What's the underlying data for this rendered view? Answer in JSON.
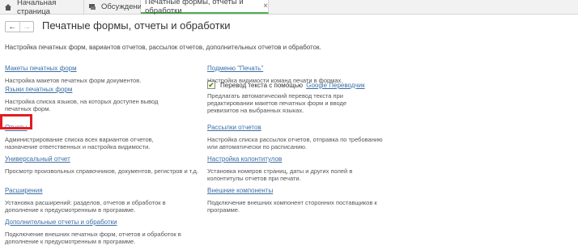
{
  "tabs": [
    {
      "label": "Начальная страница",
      "icon": "home-icon"
    },
    {
      "label": "Обсуждения",
      "icon": "chat-icon"
    },
    {
      "label": "Печатные формы, отчеты и обработки",
      "icon": "",
      "active": true
    }
  ],
  "header": {
    "title": "Печатные формы, отчеты и обработки",
    "description": "Настройка печатных форм, вариантов отчетов, рассылок отчетов, дополнительных отчетов и обработок."
  },
  "left_items": [
    {
      "label": "Макеты печатных форм",
      "desc": [
        "Настройка макетов печатных форм документов."
      ]
    },
    {
      "label": "Языки печатных форм",
      "desc": [
        "Настройка списка языков, на которых доступен вывод",
        "печатных форм."
      ]
    },
    {
      "label": "Отчеты",
      "desc": [
        "Администрирование списка всех вариантов отчетов,",
        "назначение ответственных и настройка видимости."
      ]
    },
    {
      "label": "Универсальный отчет",
      "desc": [
        "Просмотр произвольных справочников, документов, регистров и т.д."
      ]
    },
    {
      "label": "Расширения",
      "desc": [
        "Установка расширений: разделов, отчетов и обработок в",
        "дополнение к предусмотренным в программе."
      ]
    },
    {
      "label": "Дополнительные отчеты и обработки",
      "desc": [
        "Подключение внешних печатных форм, отчетов и обработок в",
        "дополнение к предусмотренным в программе."
      ]
    }
  ],
  "right_items": [
    {
      "label": "Подменю \"Печать\"",
      "desc": [
        "Настройка видимости команд печати в формах."
      ]
    },
    {
      "label": "Рассылки отчетов",
      "desc": [
        "Настройка списка рассылок отчетов, отправка по требованию",
        "или автоматически по расписанию."
      ]
    },
    {
      "label": "Настройка колонтитулов",
      "desc": [
        "Установка номеров страниц, даты и других полей в",
        "колонтитулы отчетов при печати."
      ]
    },
    {
      "label": "Внешние компоненты",
      "desc": [
        "Подключение внешних компонент сторонних поставщиков к",
        "программе."
      ]
    }
  ],
  "google_translate": {
    "checked": true,
    "text": "Перевод текста с помощью",
    "link": "Google Переводчик",
    "desc": [
      "Предлагать автоматический перевод текста при",
      "редактировании макетов печатных форм и вводе",
      "реквизитов на выбранных языках."
    ]
  },
  "colors": {
    "link": "#3a6ea5",
    "highlight": "#e31b23",
    "active_tab_underline": "#4caf50"
  }
}
